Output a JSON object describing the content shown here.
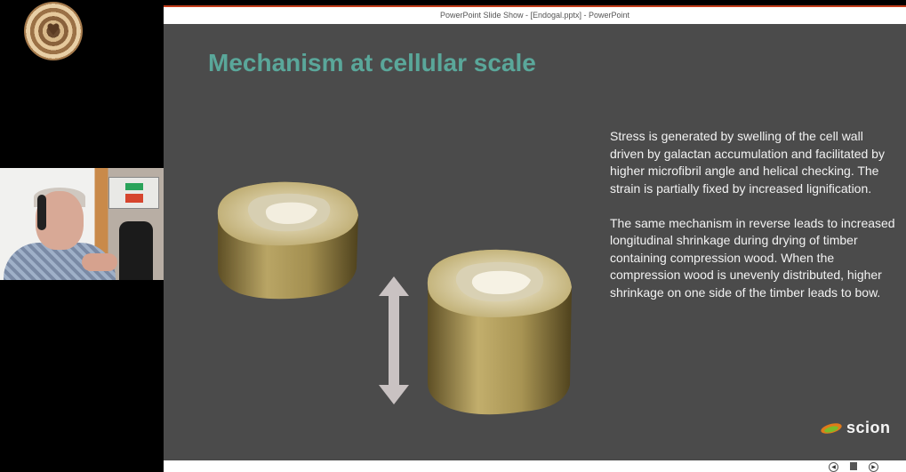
{
  "window": {
    "title": "PowerPoint Slide Show - [Endogal.pptx] - PowerPoint"
  },
  "slide": {
    "title": "Mechanism at cellular scale",
    "paragraphs": [
      [
        "Stress is generated by swelling of the cell wall",
        "driven by galactan accumulation and facilitated by",
        "higher microfibril angle and helical checking. The",
        "strain is partially fixed by increased lignification."
      ],
      [
        "The same mechanism in reverse leads to increased",
        "longitudinal shrinkage during drying of timber",
        "containing compression wood. When the",
        "compression wood is unevenly distributed, higher",
        "shrinkage on one side of the timber leads to bow."
      ]
    ],
    "brand": "scion"
  },
  "colors": {
    "title": "#5aa79a",
    "slide_bg": "#4b4b4b",
    "accent_bar": "#c43e1c",
    "wood": "#b09a5a"
  },
  "icons": {
    "logo": "wood-rings-heart-logo",
    "arrow": "double-headed-vertical-arrow",
    "nav_prev": "previous-icon",
    "nav_view": "slide-view-icon",
    "nav_next": "next-icon"
  }
}
